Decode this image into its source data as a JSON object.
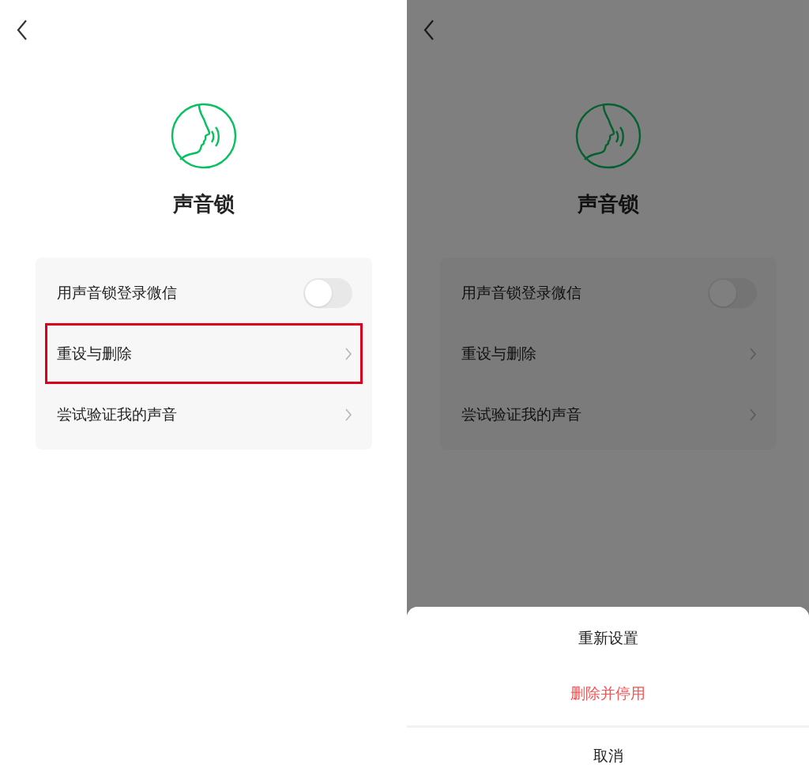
{
  "screens": [
    {
      "title": "声音锁",
      "dimmed": false,
      "items": [
        {
          "kind": "toggle",
          "label": "用声音锁登录微信",
          "on": false,
          "highlighted": false
        },
        {
          "kind": "link",
          "label": "重设与删除",
          "highlighted": true
        },
        {
          "kind": "link",
          "label": "尝试验证我的声音",
          "highlighted": false
        }
      ]
    },
    {
      "title": "声音锁",
      "dimmed": true,
      "items": [
        {
          "kind": "toggle",
          "label": "用声音锁登录微信",
          "on": false,
          "highlighted": false
        },
        {
          "kind": "link",
          "label": "重设与删除",
          "highlighted": false
        },
        {
          "kind": "link",
          "label": "尝试验证我的声音",
          "highlighted": false
        }
      ],
      "action_sheet": {
        "actions": [
          {
            "label": "重新设置",
            "destructive": false
          },
          {
            "label": "删除并停用",
            "destructive": true
          }
        ],
        "cancel": "取消"
      }
    }
  ]
}
